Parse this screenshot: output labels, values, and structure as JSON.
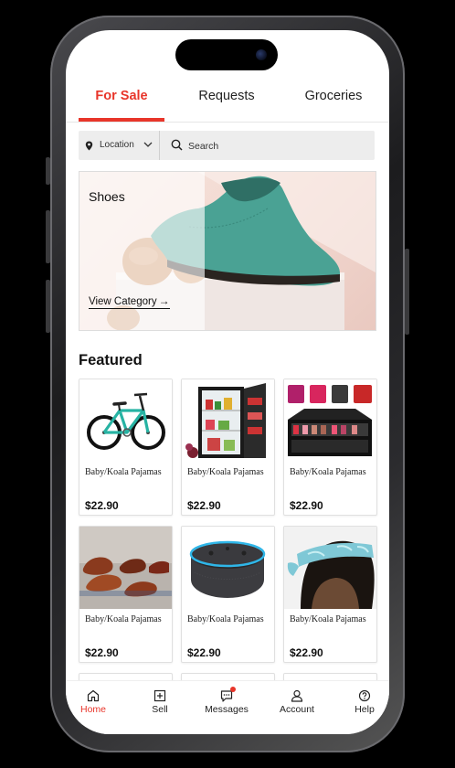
{
  "tabs": [
    {
      "label": "For Sale",
      "active": true
    },
    {
      "label": "Requests",
      "active": false
    },
    {
      "label": "Groceries",
      "active": false
    }
  ],
  "search": {
    "location_label": "Location",
    "placeholder": "Search"
  },
  "banner": {
    "title": "Shoes",
    "link_label": "View Category",
    "link_arrow": "→"
  },
  "featured": {
    "title": "Featured",
    "items": [
      {
        "name": "Baby/Koala Pajamas",
        "price": "$22.90",
        "image": "bicycle"
      },
      {
        "name": "Baby/Koala Pajamas",
        "price": "$22.90",
        "image": "mini-fridge"
      },
      {
        "name": "Baby/Koala Pajamas",
        "price": "$22.90",
        "image": "makeup-cases"
      },
      {
        "name": "Baby/Koala Pajamas",
        "price": "$22.90",
        "image": "leather-shoes"
      },
      {
        "name": "Baby/Koala Pajamas",
        "price": "$22.90",
        "image": "smart-speaker"
      },
      {
        "name": "Baby/Koala Pajamas",
        "price": "$22.90",
        "image": "headband"
      }
    ]
  },
  "bottom_nav": [
    {
      "label": "Home",
      "icon": "home-icon",
      "active": true
    },
    {
      "label": "Sell",
      "icon": "plus-square-icon",
      "active": false
    },
    {
      "label": "Messages",
      "icon": "chat-bubble-icon",
      "active": false,
      "has_badge": true
    },
    {
      "label": "Account",
      "icon": "user-icon",
      "active": false
    },
    {
      "label": "Help",
      "icon": "help-circle-icon",
      "active": false
    }
  ],
  "colors": {
    "accent": "#e8352a",
    "search_bg": "#ededed",
    "background": "#000000"
  }
}
